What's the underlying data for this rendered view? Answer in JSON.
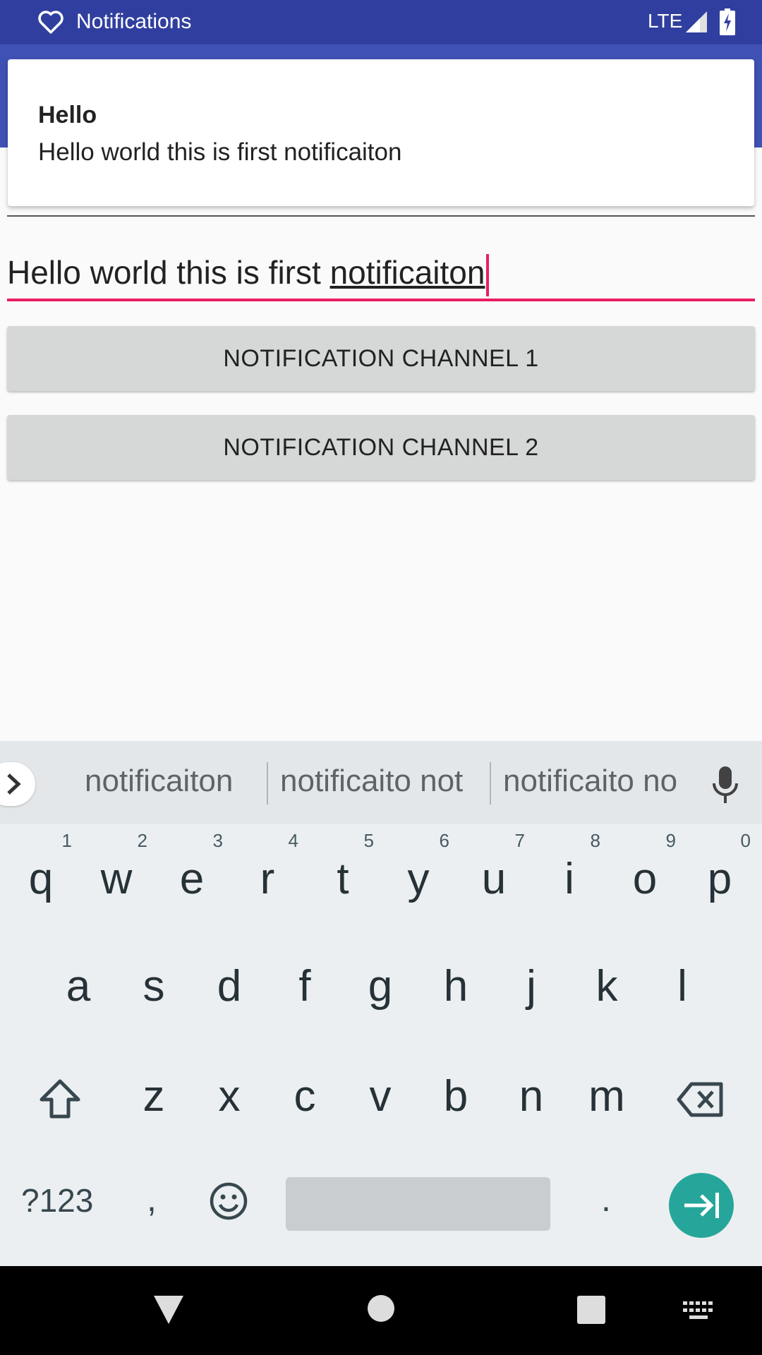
{
  "status_bar": {
    "title": "Notifications",
    "network": "LTE"
  },
  "notification": {
    "title": "Hello",
    "text": "Hello world this is first notificaiton"
  },
  "input": {
    "text_prefix": "Hello world this is first ",
    "text_underlined": "notificaiton"
  },
  "buttons": {
    "channel1": "NOTIFICATION CHANNEL 1",
    "channel2": "NOTIFICATION CHANNEL 2"
  },
  "keyboard": {
    "suggestions": [
      "notificaiton",
      "notificaito not",
      "notificaito no"
    ],
    "row1": [
      {
        "key": "q",
        "hint": "1"
      },
      {
        "key": "w",
        "hint": "2"
      },
      {
        "key": "e",
        "hint": "3"
      },
      {
        "key": "r",
        "hint": "4"
      },
      {
        "key": "t",
        "hint": "5"
      },
      {
        "key": "y",
        "hint": "6"
      },
      {
        "key": "u",
        "hint": "7"
      },
      {
        "key": "i",
        "hint": "8"
      },
      {
        "key": "o",
        "hint": "9"
      },
      {
        "key": "p",
        "hint": "0"
      }
    ],
    "row2": [
      "a",
      "s",
      "d",
      "f",
      "g",
      "h",
      "j",
      "k",
      "l"
    ],
    "row3": [
      "z",
      "x",
      "c",
      "v",
      "b",
      "n",
      "m"
    ],
    "symbols_label": "?123",
    "comma": ",",
    "period": "."
  },
  "colors": {
    "status_bar": "#303f9f",
    "app_bar": "#3f51b5",
    "accent": "#e91e63",
    "enter_key": "#26a69a"
  }
}
